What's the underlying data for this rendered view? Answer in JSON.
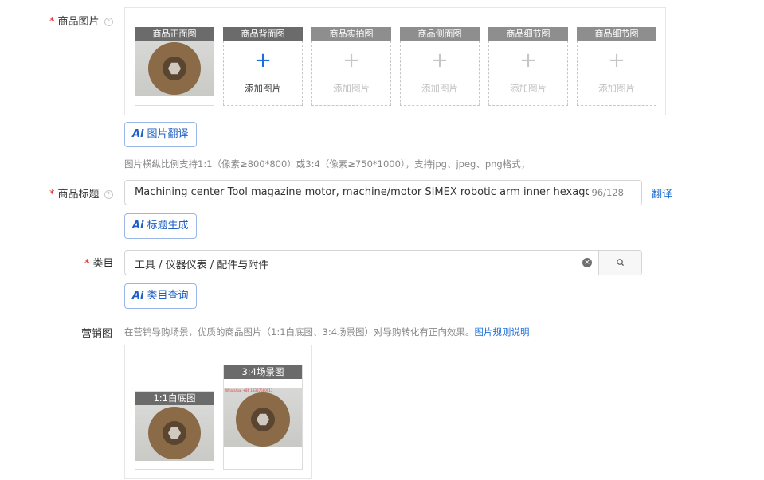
{
  "product_images": {
    "label": "商品图片",
    "slots": [
      {
        "title": "商品正面图",
        "filled": true
      },
      {
        "title": "商品背面图",
        "add_text": "添加图片",
        "active": true
      },
      {
        "title": "商品实拍图",
        "add_text": "添加图片",
        "active": false
      },
      {
        "title": "商品侧面图",
        "add_text": "添加图片",
        "active": false
      },
      {
        "title": "商品细节图",
        "add_text": "添加图片",
        "active": false
      },
      {
        "title": "商品细节图",
        "add_text": "添加图片",
        "active": false
      }
    ],
    "ai_button": "图片翻译",
    "hint": "图片横纵比例支持1:1（像素≥800*800）或3:4（像素≥750*1000），支持jpg、jpeg、png格式；"
  },
  "title_field": {
    "label": "商品标题",
    "value": "Machining center Tool magazine motor, machine/motor SIMEX robotic arm inner hexagona",
    "counter": "96/128",
    "translate_link": "翻译",
    "ai_button": "标题生成"
  },
  "category_field": {
    "label": "类目",
    "value": "工具 / 仪器仪表 / 配件与附件",
    "ai_button": "类目查询"
  },
  "marketing": {
    "label": "营销图",
    "hint": "在营销导购场景，优质的商品图片（1:1白底图、3:4场景图）对导购转化有正向效果。",
    "rules_link": "图片规则说明",
    "white_bg_title": "1:1白底图",
    "scene_title": "3:4场景图",
    "watermark": "WhatsApp +86 13367580913"
  },
  "icons": {
    "required_mark": "*",
    "help": "?",
    "plus": "+",
    "clear": "×",
    "ai_mark": "Ai"
  },
  "colors": {
    "accent": "#1e6fd9",
    "required": "#e02020",
    "slot_header": "#6b6b6b"
  }
}
